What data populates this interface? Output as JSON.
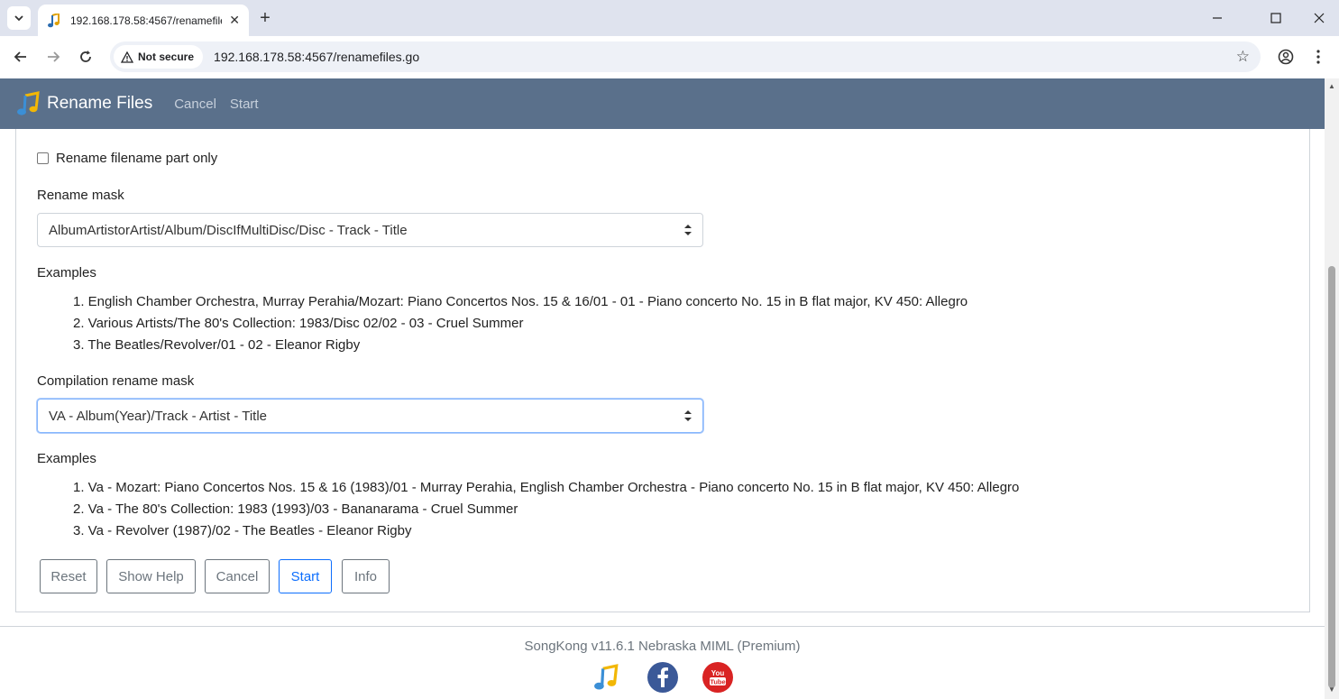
{
  "browser": {
    "tab_title": "192.168.178.58:4567/renamefile",
    "security_label": "Not secure",
    "url": "192.168.178.58:4567/renamefiles.go"
  },
  "navbar": {
    "brand": "Rename Files",
    "links": [
      "Cancel",
      "Start"
    ],
    "color": "#5a708b"
  },
  "form": {
    "rename_filename_only_label": "Rename filename part only",
    "rename_filename_only_checked": false,
    "rename_mask_label": "Rename mask",
    "rename_mask_value": "AlbumArtistorArtist/Album/DiscIfMultiDisc/Disc - Track - Title",
    "examples_label": "Examples",
    "examples": [
      "1. English Chamber Orchestra, Murray Perahia/Mozart: Piano Concertos Nos. 15 & 16/01 - 01 - Piano concerto No. 15 in B flat major, KV 450: Allegro",
      "2. Various Artists/The 80's Collection: 1983/Disc 02/02 - 03 - Cruel Summer",
      "3. The Beatles/Revolver/01 - 02 - Eleanor Rigby"
    ],
    "compilation_mask_label": "Compilation rename mask",
    "compilation_mask_value": "VA - Album(Year)/Track - Artist - Title",
    "compilation_examples_label": "Examples",
    "compilation_examples": [
      "1. Va - Mozart: Piano Concertos Nos. 15 & 16 (1983)/01 - Murray Perahia, English Chamber Orchestra - Piano concerto No. 15 in B flat major, KV 450: Allegro",
      "2. Va - The 80's Collection: 1983 (1993)/03 - Bananarama - Cruel Summer",
      "3. Va - Revolver (1987)/02 - The Beatles - Eleanor Rigby"
    ],
    "buttons": {
      "reset": "Reset",
      "show_help": "Show Help",
      "cancel": "Cancel",
      "start": "Start",
      "info": "Info"
    }
  },
  "footer": {
    "text": "SongKong v11.6.1 Nebraska MIML (Premium)",
    "icons": [
      "songkong-icon",
      "facebook-icon",
      "youtube-icon"
    ]
  }
}
